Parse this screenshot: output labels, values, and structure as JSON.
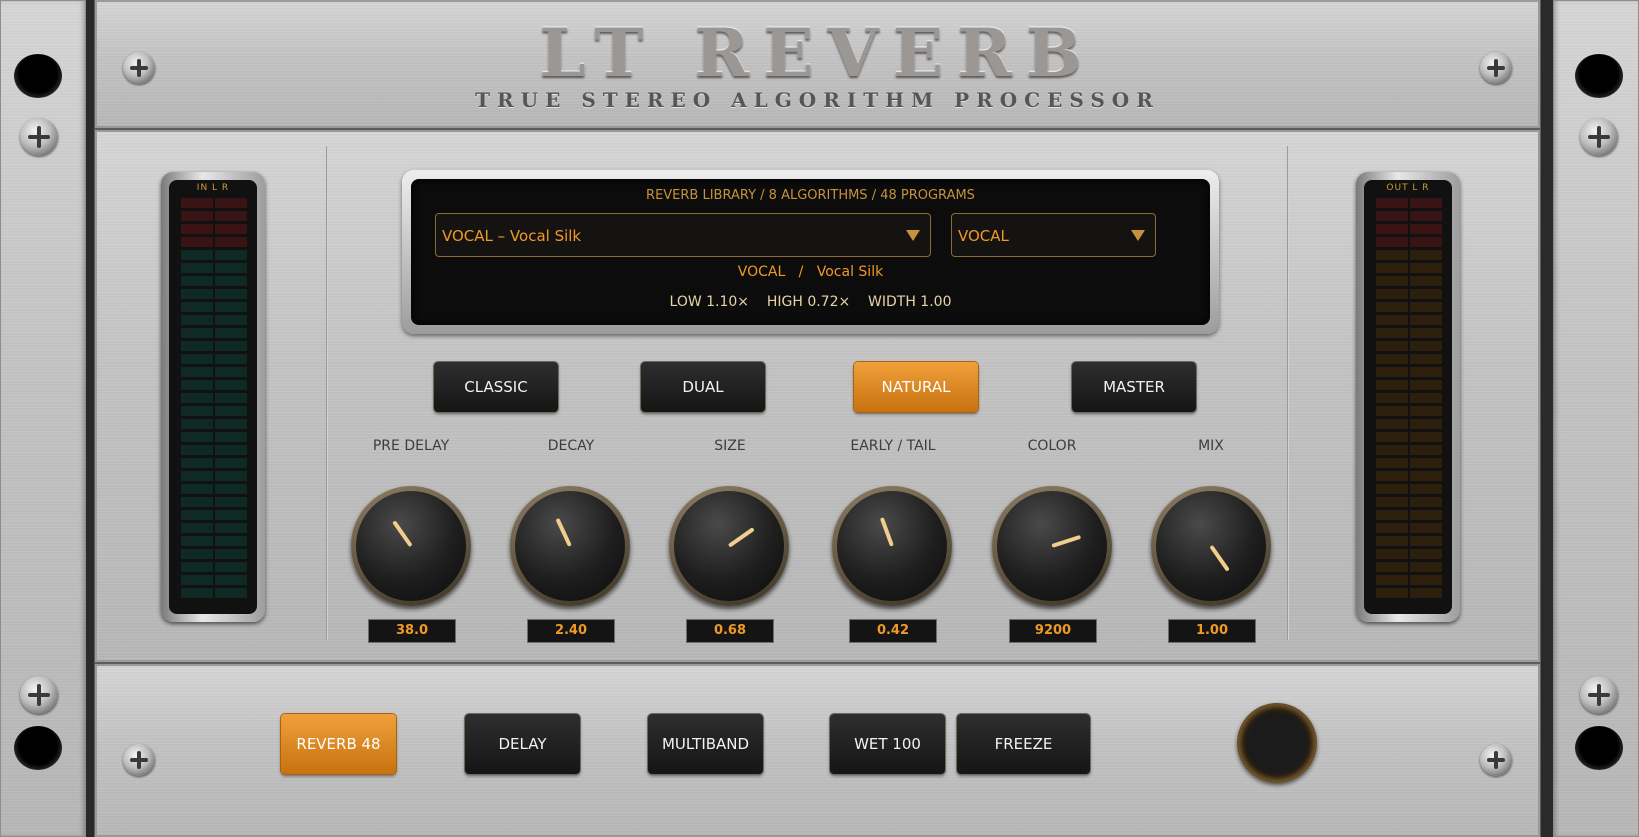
{
  "app": {
    "title": "LT REVERB",
    "subtitle": "TRUE STEREO ALGORITHM PROCESSOR"
  },
  "meters": {
    "input": {
      "label": "IN  L  R",
      "level": 0.0
    },
    "output": {
      "label": "OUT L  R",
      "level": 0.0
    }
  },
  "display": {
    "header": "REVERB LIBRARY  /  8 ALGORITHMS  /  48 PROGRAMS",
    "program_select": "VOCAL  –  Vocal Silk",
    "category_select": "VOCAL",
    "current": {
      "category": "VOCAL",
      "separator": "/",
      "program": "Vocal Silk"
    },
    "info": "LOW 1.10×    HIGH 0.72×    WIDTH 1.00"
  },
  "modes": [
    {
      "label": "CLASSIC",
      "active": false
    },
    {
      "label": "DUAL",
      "active": false
    },
    {
      "label": "NATURAL",
      "active": true
    },
    {
      "label": "MASTER",
      "active": false
    }
  ],
  "knobs": [
    {
      "label": "PRE DELAY",
      "value": "38.0",
      "angle": -35
    },
    {
      "label": "DECAY",
      "value": "2.40",
      "angle": -25
    },
    {
      "label": "SIZE",
      "value": "0.68",
      "angle": 55
    },
    {
      "label": "EARLY / TAIL",
      "value": "0.42",
      "angle": -20
    },
    {
      "label": "COLOR",
      "value": "9200",
      "angle": 72
    },
    {
      "label": "MIX",
      "value": "1.00",
      "angle": 145
    }
  ],
  "footer_buttons": [
    {
      "label": "REVERB 48",
      "active": true
    },
    {
      "label": "DELAY",
      "active": false
    },
    {
      "label": "MULTIBAND",
      "active": false
    },
    {
      "label": "WET 100",
      "active": false
    },
    {
      "label": "FREEZE",
      "active": false
    }
  ],
  "colors": {
    "accent": "#ef9a26",
    "active_button": "#e08b24",
    "meter_green": "#0f2a25",
    "meter_red": "#3a1414",
    "meter_amber": "#2d1f0d"
  }
}
